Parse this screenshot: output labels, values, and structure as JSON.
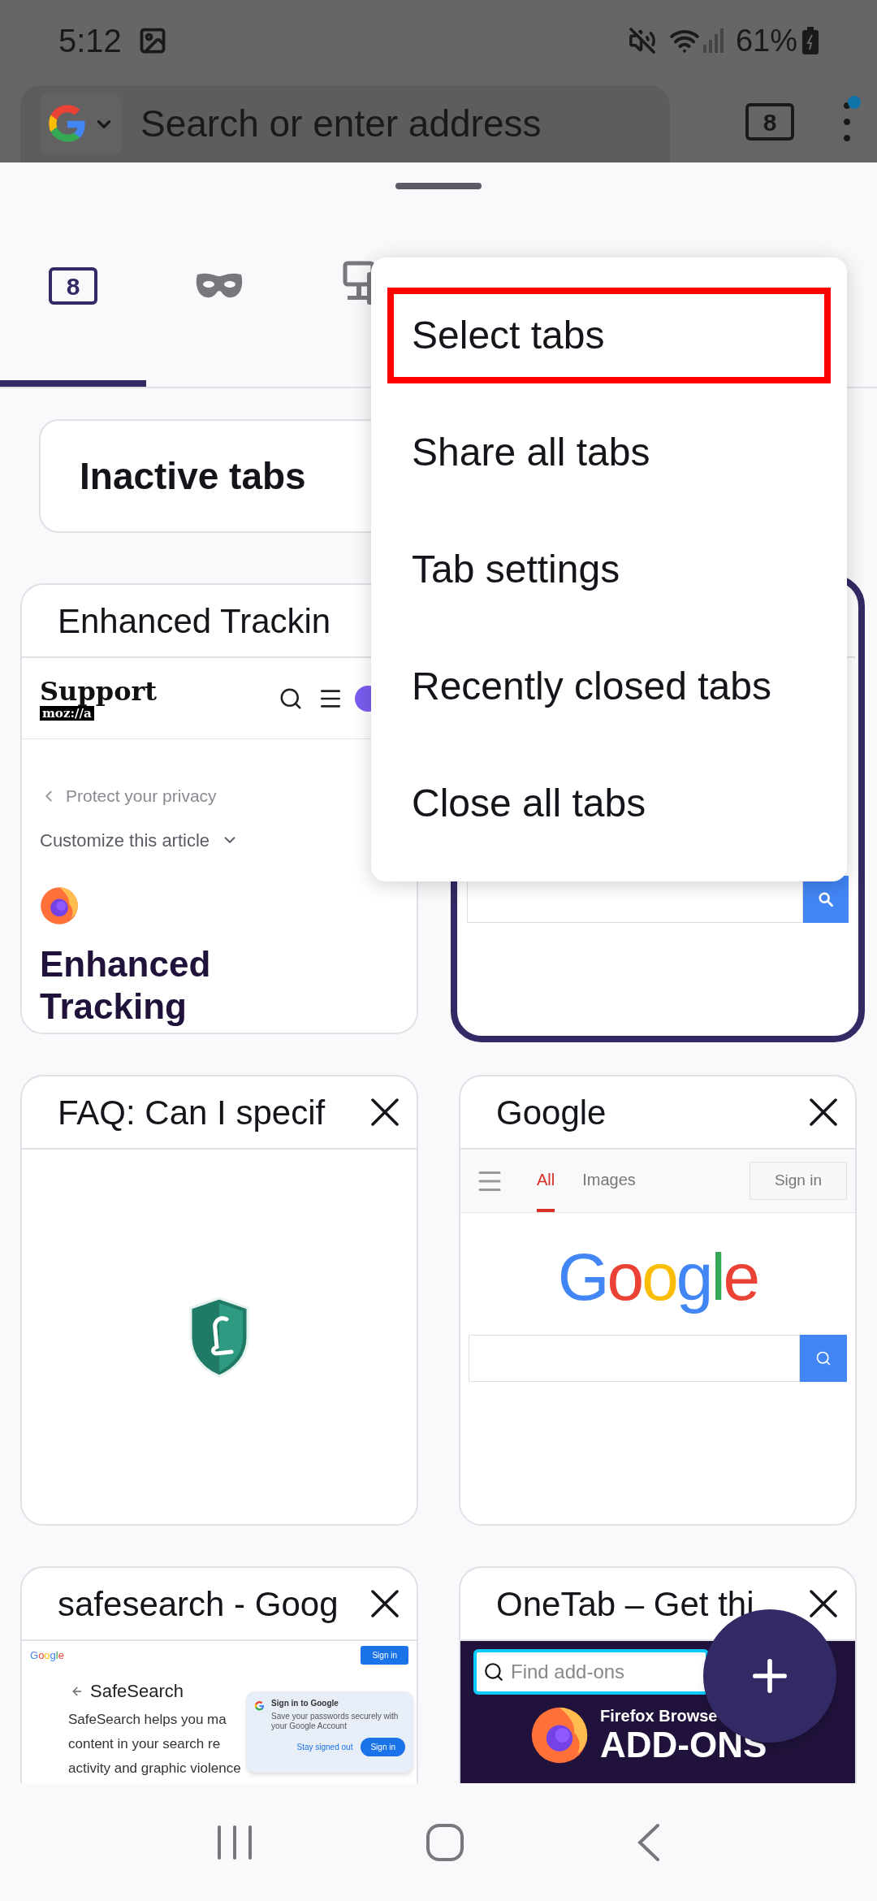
{
  "status_bar": {
    "time": "5:12",
    "battery": "61%"
  },
  "toolbar": {
    "placeholder": "Search or enter address",
    "tab_count": "8"
  },
  "tray_tabs": [
    {
      "kind": "count",
      "label": "8",
      "selected": true
    },
    {
      "kind": "private",
      "selected": false
    },
    {
      "kind": "synced",
      "selected": false
    }
  ],
  "inactive_tabs": {
    "label": "Inactive tabs"
  },
  "cards": [
    {
      "title": "Enhanced Trackin",
      "selected": false,
      "close": false,
      "preview": {
        "kind": "support",
        "logo": "Support",
        "badge": "moz://a",
        "breadcrumb": "Protect your privacy",
        "dropdown": "Customize this article",
        "heading": "Enhanced Tracking"
      }
    },
    {
      "selected": true,
      "close": false,
      "preview": {
        "kind": "search"
      }
    },
    {
      "title": "FAQ: Can I specif",
      "selected": false,
      "close": true,
      "preview": {
        "kind": "shield"
      }
    },
    {
      "title": "Google",
      "selected": false,
      "close": true,
      "preview": {
        "kind": "google",
        "tabs": [
          {
            "label": "All",
            "selected": true
          },
          {
            "label": "Images",
            "selected": false
          }
        ],
        "sign_in": "Sign in",
        "logo": "Google"
      }
    },
    {
      "title": "safesearch - Goog",
      "selected": false,
      "close": true,
      "preview": {
        "kind": "safesearch",
        "logo": "Google",
        "sign_in": "Sign in",
        "back": "SafeSearch",
        "lines": [
          "SafeSearch helps you ma",
          "content in your search re",
          "activity and graphic violence"
        ],
        "popup": {
          "title": "Sign in to Google",
          "text": "Save your passwords securely with your Google Account",
          "dismiss": "Stay signed out",
          "confirm": "Sign in"
        }
      }
    },
    {
      "title": "OneTab – Get thi",
      "selected": false,
      "close": true,
      "preview": {
        "kind": "addons",
        "search": "Find add-ons",
        "brand": "Firefox Browse",
        "heading": "ADD-ONS"
      }
    }
  ],
  "menu": {
    "items": [
      {
        "label": "Select tabs",
        "highlighted": true
      },
      {
        "label": "Share all tabs",
        "highlighted": false
      },
      {
        "label": "Tab settings",
        "highlighted": false
      },
      {
        "label": "Recently closed tabs",
        "highlighted": false
      },
      {
        "label": "Close all tabs",
        "highlighted": false
      }
    ]
  }
}
